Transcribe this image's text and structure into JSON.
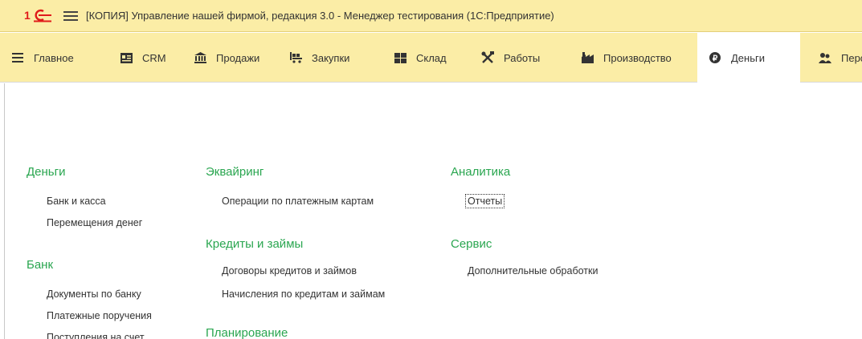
{
  "window": {
    "title": "[КОПИЯ] Управление нашей фирмой, редакция 3.0  - Менеджер тестирования (1С:Предприятие)"
  },
  "sections": [
    {
      "label": "Главное",
      "icon": "list-icon"
    },
    {
      "label": "CRM",
      "icon": "contact-card-icon"
    },
    {
      "label": "Продажи",
      "icon": "shop-icon"
    },
    {
      "label": "Закупки",
      "icon": "cart-icon"
    },
    {
      "label": "Склад",
      "icon": "warehouse-icon"
    },
    {
      "label": "Работы",
      "icon": "tools-icon"
    },
    {
      "label": "Производство",
      "icon": "factory-icon"
    },
    {
      "label": "Деньги",
      "icon": "ruble-icon",
      "active": true
    },
    {
      "label": "Персо",
      "icon": "people-icon"
    }
  ],
  "groups": {
    "money": {
      "title": "Деньги",
      "items": [
        "Банк и касса",
        "Перемещения денег"
      ]
    },
    "bank": {
      "title": "Банк",
      "items": [
        "Документы по банку",
        "Платежные поручения",
        "Поступления на счет"
      ]
    },
    "acquiring": {
      "title": "Эквайринг",
      "items": [
        "Операции по платежным картам"
      ]
    },
    "credits": {
      "title": "Кредиты и займы",
      "items": [
        "Договоры кредитов и займов",
        "Начисления по кредитам и займам"
      ]
    },
    "planning": {
      "title": "Планирование"
    },
    "analytics": {
      "title": "Аналитика",
      "items": [
        "Отчеты"
      ]
    },
    "service": {
      "title": "Сервис",
      "items": [
        "Дополнительные обработки"
      ]
    }
  },
  "colors": {
    "header_bg": "#fbeda6",
    "group_title": "#2aa650",
    "logo_red": "#e01b1b"
  }
}
